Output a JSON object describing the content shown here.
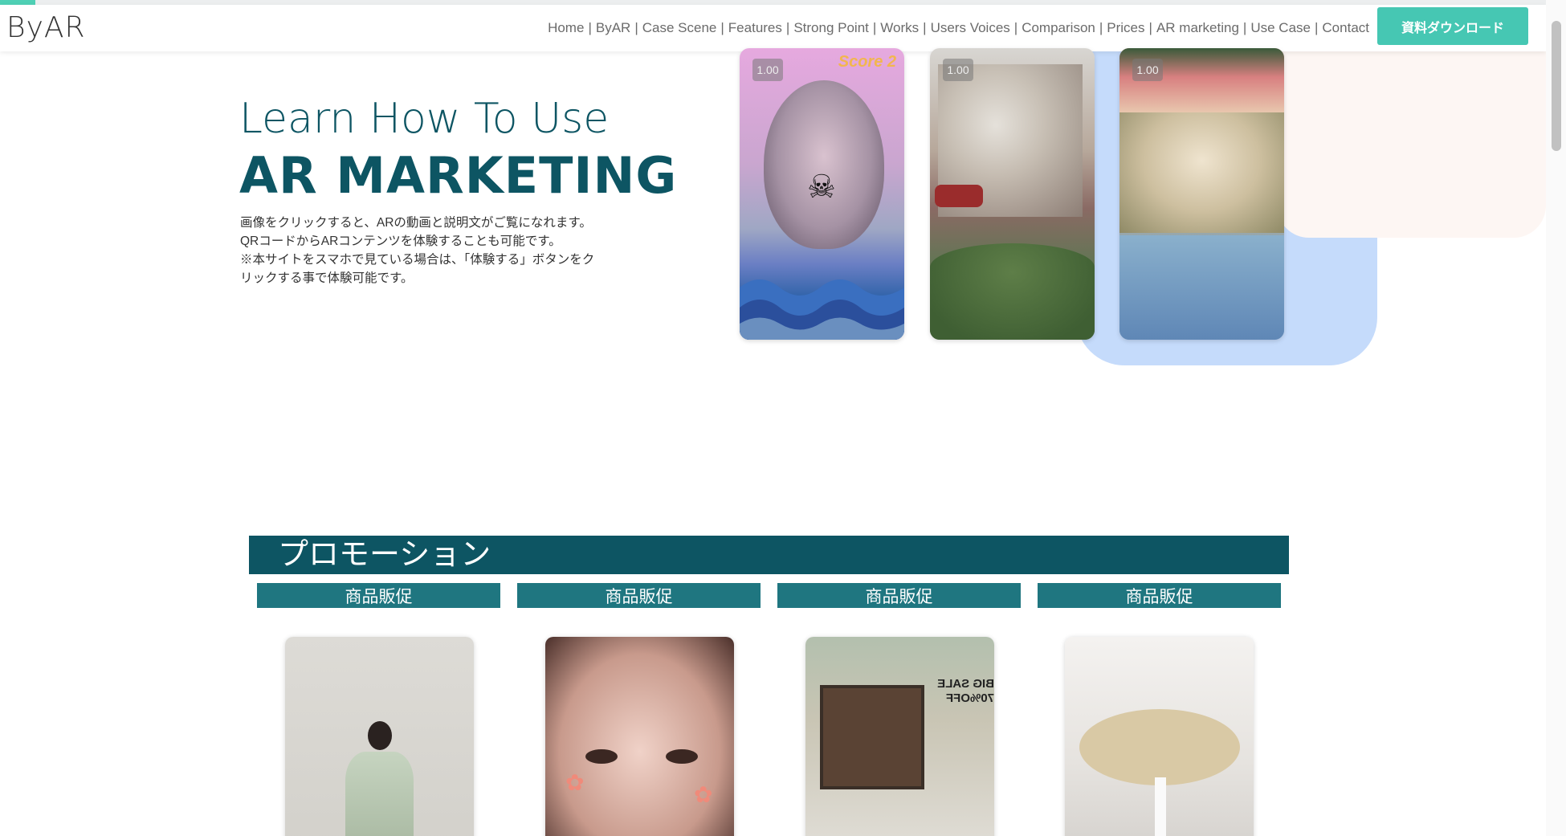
{
  "header": {
    "logo": "ByAR",
    "nav": [
      {
        "label": "Home"
      },
      {
        "label": "ByAR"
      },
      {
        "label": "Case Scene"
      },
      {
        "label": "Features"
      },
      {
        "label": "Strong Point"
      },
      {
        "label": "Works"
      },
      {
        "label": "Users Voices"
      },
      {
        "label": "Comparison"
      },
      {
        "label": "Prices"
      },
      {
        "label": "AR marketing"
      },
      {
        "label": "Use Case"
      },
      {
        "label": "Contact"
      }
    ],
    "download_label": "資料ダウンロード"
  },
  "hero": {
    "title_line1": "Learn How To Use",
    "title_line2": "AR MARKETING",
    "desc_line1": "画像をクリックすると、ARの動画と説明文がご覧になれます。",
    "desc_line2": "QRコードからARコンテンツを体験することも可能です。",
    "desc_line3": "※本サイトをスマホで見ている場合は、「体験する」ボタンをク",
    "desc_line4": "リックする事で体験可能です。"
  },
  "video_cards": [
    {
      "speed": "1.00",
      "overlay": "Score 2"
    },
    {
      "speed": "1.00"
    },
    {
      "speed": "1.00"
    }
  ],
  "promotion": {
    "title": "プロモーション",
    "categories": [
      "商品販促",
      "商品販促",
      "商品販促",
      "商品販促"
    ],
    "thumb3_text": "BIG SALE 70%OFF"
  },
  "colors": {
    "primary": "#0d5563",
    "secondary": "#1f7680",
    "accent": "#46c7b3",
    "blob_blue": "#c5dbfb"
  }
}
